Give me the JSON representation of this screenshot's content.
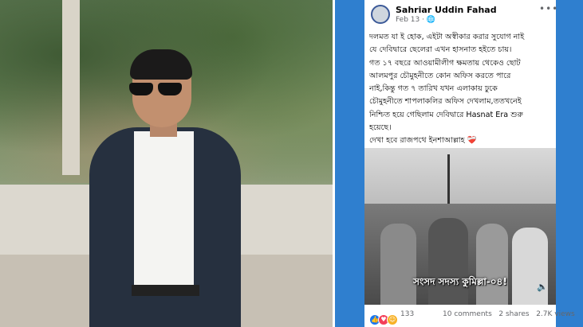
{
  "post": {
    "author": "Sahriar Uddin Fahad",
    "date": "Feb 13",
    "privacy_icon": "globe-icon",
    "more_icon": "more-horizontal-icon",
    "body_lines": [
      "দলমত যা ই হোক, এইটা অস্বীকার করার সুযোগ নাই",
      "যে দেবিদ্বারে ছেলেরা এখন হাসনাত হইতে চায়।",
      "গত ১৭ বছরে আওয়ামীলীগ ক্ষমতায় থেকেও ছোট",
      "আলমপুর চৌমুহনীতে কোন অফিস করতে পারে",
      "নাই,কিন্তু গত ৭ তারিখ যখন এলাকায় ঢুকে",
      "চৌমুহনীতে শাপলাকলির অফিস দেখলাম,ততখনেই",
      "নিশ্চিত হয়ে গেছিলাম দেবিদ্বারে Hasnat Era শুরু",
      "হয়েছে।",
      "দেখা হবে রাজপথে ইনশাআল্লাহ"
    ],
    "heart_emoji": "❤️‍🩹",
    "video_caption": "সংসদ সদস্য কুমিল্লা-০৪!",
    "reaction_count": "133",
    "comments": "10 comments",
    "shares": "2 shares",
    "views": "2.7K views"
  },
  "colors": {
    "accent_bg": "#2f7fcf",
    "like": "#1877f2",
    "love": "#f33e58"
  }
}
